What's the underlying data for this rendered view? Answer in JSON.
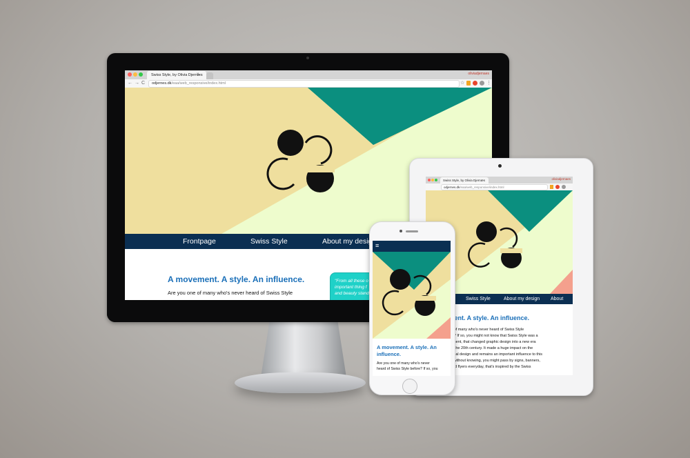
{
  "browser": {
    "tab_title": "Swiss Style, by Olivia Djernæs",
    "tab_close": "×",
    "profile": "oliviadjernaes",
    "url_host": "odjernes.dk",
    "url_path": "/eaa/web_responsive/index.html",
    "back_icon": "←",
    "forward_icon": "→",
    "reload_icon": "C",
    "star_icon": "☆",
    "menu_icon": "⋮"
  },
  "ipad_browser": {
    "tab_title": "Swiss Style, by Olivia Djernæs",
    "url_host": "odjernes.dk",
    "url_path": "/eaa/web_responsive/index.html",
    "profile": "oliviadjernaes"
  },
  "nav": {
    "items": [
      "Frontpage",
      "Swiss Style",
      "About my design",
      "About"
    ]
  },
  "content": {
    "heading": "A movement. A style. An influence.",
    "intro_line1": "Are you one of many who's never heard of Swiss Style",
    "quote_line1": "\"From all these o",
    "quote_line2": "important thing f",
    "quote_line3": "and beauty stand"
  },
  "ipad_content": {
    "heading": "nent. A style. An influence.",
    "lines": [
      "e of many who's never heard of Swiss Style",
      "re? If so, you might not know that Swiss Style was a",
      "ement, that changed graphic design into a new era",
      "in the 20th century. It made a huge impact on the",
      "strial design and remains an important influence to this",
      "o without knowing, you might pass by signs, banners,",
      "and flyers everyday, that's inspired by the Swiss"
    ]
  },
  "iphone_content": {
    "menu_icon": "≡",
    "heading_line1": "A movement. A style. An",
    "heading_line2": "influence.",
    "body_line1": "Are you one of many who's never",
    "body_line2": "heard of Swiss Style before? If so, you"
  },
  "colors": {
    "hero_cream": "#efdf9e",
    "hero_mint": "#eefccd",
    "hero_teal": "#0b8f7f",
    "hero_salmon": "#f4a08d",
    "nav_navy": "#0b2f52",
    "heading_blue": "#1a6fb8",
    "quote_cyan": "#1fd1c8"
  }
}
